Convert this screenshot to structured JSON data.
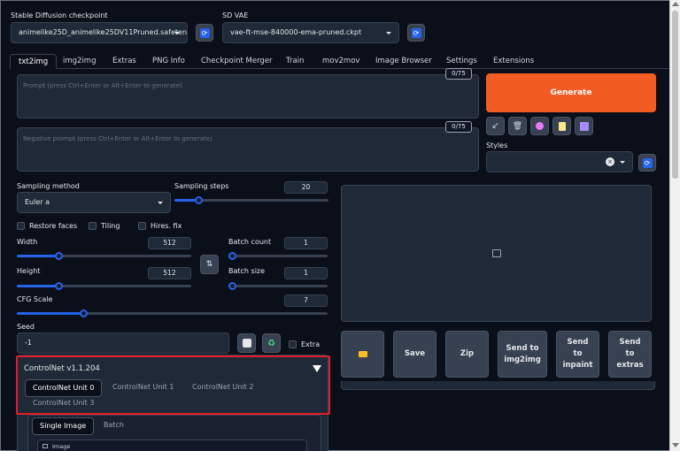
{
  "top": {
    "checkpoint_label": "Stable Diffusion checkpoint",
    "checkpoint_value": "animelike25D_animelike25DV11Pruned.safeten",
    "vae_label": "SD VAE",
    "vae_value": "vae-ft-mse-840000-ema-pruned.ckpt"
  },
  "tabs": [
    "txt2img",
    "img2img",
    "Extras",
    "PNG Info",
    "Checkpoint Merger",
    "Train",
    "mov2mov",
    "Image Browser",
    "Settings",
    "Extensions"
  ],
  "prompt": {
    "placeholder": "Prompt (press Ctrl+Enter or Alt+Enter to generate)",
    "counter": "0/75",
    "negative_placeholder": "Negative prompt (press Ctrl+Enter or Alt+Enter to generate)",
    "negative_counter": "0/75"
  },
  "actions": {
    "generate": "Generate",
    "styles_label": "Styles"
  },
  "params": {
    "sampling_method_label": "Sampling method",
    "sampling_method_value": "Euler a",
    "sampling_steps_label": "Sampling steps",
    "sampling_steps_value": "20",
    "restore_faces": "Restore faces",
    "tiling": "Tiling",
    "hires_fix": "Hires. fix",
    "width_label": "Width",
    "width_value": "512",
    "height_label": "Height",
    "height_value": "512",
    "batch_count_label": "Batch count",
    "batch_count_value": "1",
    "batch_size_label": "Batch size",
    "batch_size_value": "1",
    "cfg_label": "CFG Scale",
    "cfg_value": "7",
    "seed_label": "Seed",
    "seed_value": "-1",
    "extra_label": "Extra"
  },
  "output_buttons": {
    "save": "Save",
    "zip": "Zip",
    "send_img2img": "Send to img2img",
    "send_inpaint": "Send to inpaint",
    "send_extras": "Send to extras"
  },
  "controlnet": {
    "title": "ControlNet v1.1.204",
    "units": [
      "ControlNet Unit 0",
      "ControlNet Unit 1",
      "ControlNet Unit 2",
      "ControlNet Unit 3"
    ],
    "subtabs": [
      "Single Image",
      "Batch"
    ],
    "image_label": "Image"
  },
  "colors": {
    "background": "#0b0f19",
    "panel": "#1f2937",
    "accent": "#f25c22",
    "slider": "#2563eb",
    "highlight_box": "#e11d2b"
  }
}
